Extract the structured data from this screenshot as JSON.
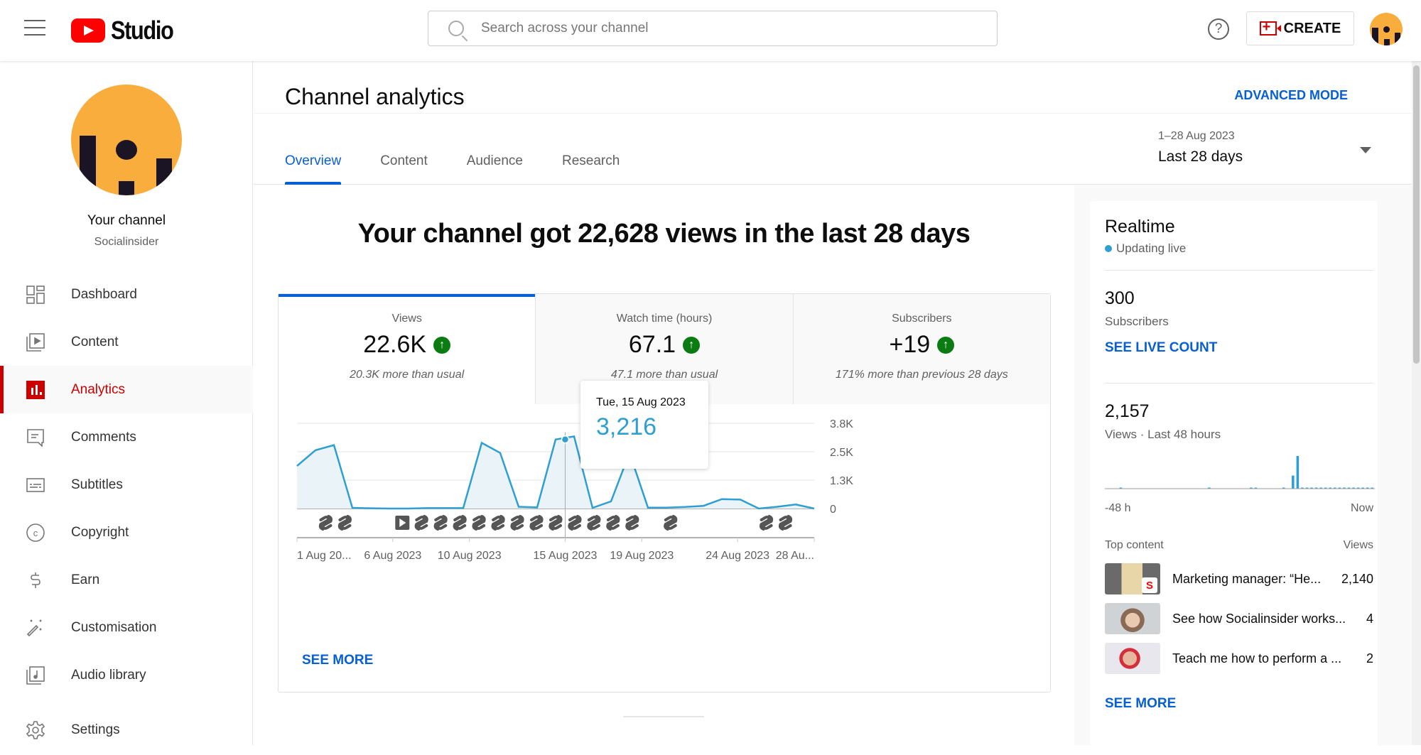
{
  "topbar": {
    "app_name": "Studio",
    "search_placeholder": "Search across your channel",
    "help_glyph": "?",
    "create_label": "CREATE"
  },
  "sidebar": {
    "channel_label": "Your channel",
    "channel_name": "Socialinsider",
    "items": [
      {
        "label": "Dashboard",
        "icon": "dashboard-icon",
        "active": false
      },
      {
        "label": "Content",
        "icon": "content-icon",
        "active": false
      },
      {
        "label": "Analytics",
        "icon": "analytics-icon",
        "active": true
      },
      {
        "label": "Comments",
        "icon": "comments-icon",
        "active": false
      },
      {
        "label": "Subtitles",
        "icon": "subtitles-icon",
        "active": false
      },
      {
        "label": "Copyright",
        "icon": "copyright-icon",
        "active": false
      },
      {
        "label": "Earn",
        "icon": "dollar-icon",
        "active": false
      },
      {
        "label": "Customisation",
        "icon": "magic-wand-icon",
        "active": false
      },
      {
        "label": "Audio library",
        "icon": "audio-library-icon",
        "active": false
      },
      {
        "label": "Settings",
        "icon": "gear-icon",
        "active": false
      }
    ]
  },
  "header": {
    "title": "Channel analytics",
    "advanced_mode": "ADVANCED MODE",
    "tabs": [
      {
        "label": "Overview",
        "active": true
      },
      {
        "label": "Content",
        "active": false
      },
      {
        "label": "Audience",
        "active": false
      },
      {
        "label": "Research",
        "active": false
      }
    ],
    "date_range": {
      "dates": "1–28 Aug 2023",
      "label": "Last 28 days"
    }
  },
  "overview": {
    "headline": "Your channel got 22,628 views in the last 28 days",
    "metrics": [
      {
        "label": "Views",
        "value": "22.6K",
        "note": "20.3K more than usual",
        "trend": "up"
      },
      {
        "label": "Watch time (hours)",
        "value": "67.1",
        "note": "47.1 more than usual",
        "trend": "up"
      },
      {
        "label": "Subscribers",
        "value": "+19",
        "note": "171% more than previous 28 days",
        "trend": "up"
      }
    ],
    "tooltip": {
      "date": "Tue, 15 Aug 2023",
      "value": "3,216"
    },
    "see_more": "SEE MORE"
  },
  "chart_data": {
    "type": "area",
    "title": "Views",
    "series": [
      {
        "name": "Views",
        "color": "#2f9fd1",
        "values": [
          1900,
          2600,
          2830,
          30,
          10,
          0,
          0,
          20,
          20,
          20,
          2930,
          2480,
          80,
          50,
          3080,
          3216,
          30,
          320,
          2480,
          40,
          40,
          70,
          120,
          420,
          400,
          0,
          80,
          180,
          0
        ]
      }
    ],
    "x": [
      "1 Aug",
      "2 Aug",
      "3 Aug",
      "4 Aug",
      "5 Aug",
      "6 Aug",
      "7 Aug",
      "8 Aug",
      "9 Aug",
      "10 Aug",
      "11 Aug",
      "12 Aug",
      "13 Aug",
      "14 Aug",
      "15 Aug",
      "16 Aug",
      "17 Aug",
      "18 Aug",
      "19 Aug",
      "20 Aug",
      "21 Aug",
      "22 Aug",
      "23 Aug",
      "24 Aug",
      "25 Aug",
      "26 Aug",
      "27 Aug",
      "28 Aug"
    ],
    "x_tick_labels": [
      {
        "day": 1,
        "label": "1 Aug 20..."
      },
      {
        "day": 6,
        "label": "6 Aug 2023"
      },
      {
        "day": 10,
        "label": "10 Aug 2023"
      },
      {
        "day": 15,
        "label": "15 Aug 2023"
      },
      {
        "day": 19,
        "label": "19 Aug 2023"
      },
      {
        "day": 24,
        "label": "24 Aug 2023"
      },
      {
        "day": 28,
        "label": "28 Au..."
      }
    ],
    "y_ticks": [
      {
        "value": 0,
        "label": "0"
      },
      {
        "value": 1266,
        "label": "1.3K"
      },
      {
        "value": 2533,
        "label": "2.5K"
      },
      {
        "value": 3800,
        "label": "3.8K"
      }
    ],
    "ylim": [
      0,
      3800
    ],
    "highlight_day": 15,
    "upload_markers": [
      {
        "day": 3,
        "type": "short"
      },
      {
        "day": 4,
        "type": "short"
      },
      {
        "day": 7,
        "type": "video"
      },
      {
        "day": 8,
        "type": "short"
      },
      {
        "day": 9,
        "type": "short"
      },
      {
        "day": 10,
        "type": "short"
      },
      {
        "day": 11,
        "type": "short"
      },
      {
        "day": 12,
        "type": "short"
      },
      {
        "day": 13,
        "type": "short"
      },
      {
        "day": 14,
        "type": "short"
      },
      {
        "day": 15,
        "type": "short"
      },
      {
        "day": 16,
        "type": "short"
      },
      {
        "day": 17,
        "type": "short"
      },
      {
        "day": 18,
        "type": "short"
      },
      {
        "day": 19,
        "type": "short"
      },
      {
        "day": 21,
        "type": "short"
      },
      {
        "day": 26,
        "type": "short"
      },
      {
        "day": 27,
        "type": "short"
      }
    ],
    "grid": true,
    "legend": "none"
  },
  "realtime": {
    "title": "Realtime",
    "status": "Updating live",
    "subscribers_value": "300",
    "subscribers_label": "Subscribers",
    "see_live_count": "SEE LIVE COUNT",
    "views_value": "2,157",
    "views_label": "Views · Last 48 hours",
    "axis_start": "-48 h",
    "axis_end": "Now",
    "hourly_views": [
      0,
      0,
      0,
      5,
      0,
      0,
      0,
      0,
      0,
      0,
      0,
      0,
      0,
      0,
      0,
      0,
      0,
      0,
      0,
      0,
      0,
      0,
      5,
      0,
      0,
      0,
      0,
      0,
      0,
      0,
      0,
      5,
      5,
      0,
      0,
      0,
      0,
      0,
      5,
      0,
      400,
      1000,
      5,
      5,
      5,
      5,
      5,
      5,
      5,
      5,
      5,
      5,
      5,
      5,
      5,
      5,
      5,
      5
    ],
    "top_content_label": "Top content",
    "views_col_label": "Views",
    "top_content": [
      {
        "title": "Marketing manager: “He...",
        "views": "2,140",
        "thumb": "short-thumbnail"
      },
      {
        "title": "See how Socialinsider works...",
        "views": "4",
        "thumb": "video-thumbnail"
      },
      {
        "title": "Teach me how to perform a ...",
        "views": "2",
        "thumb": "video-thumbnail"
      }
    ],
    "see_more": "SEE MORE"
  }
}
